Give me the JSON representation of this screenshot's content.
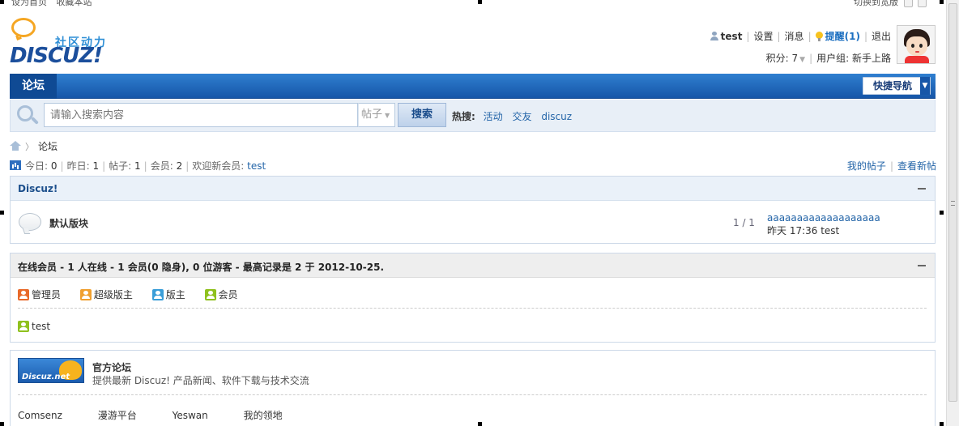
{
  "topbar": {
    "left_items": [
      "设为首页",
      "收藏本站"
    ],
    "right_label": "切换到宽版"
  },
  "logo": {
    "cn": "社区动力",
    "en": "DISCUZ!"
  },
  "user": {
    "name": "test",
    "settings": "设置",
    "messages": "消息",
    "notice": "提醒(1)",
    "logout": "退出",
    "points": "积分: 7",
    "group": "用户组: 新手上路"
  },
  "nav": {
    "forum": "论坛",
    "quicknav": "快捷导航"
  },
  "search": {
    "placeholder": "请输入搜索内容",
    "type": "帖子",
    "button": "搜索",
    "hot_label": "热搜:",
    "hot": [
      "活动",
      "交友",
      "discuz"
    ]
  },
  "breadcrumb": {
    "current": "论坛"
  },
  "stats": {
    "today_label": "今日:",
    "today": "0",
    "yesterday_label": "昨日:",
    "yesterday": "1",
    "posts_label": "帖子:",
    "posts": "1",
    "members_label": "会员:",
    "members": "2",
    "welcome_label": "欢迎新会员:",
    "welcome_user": "test",
    "my_posts": "我的帖子",
    "new_posts": "查看新帖"
  },
  "category": {
    "title": "Discuz!",
    "forum": {
      "name": "默认版块",
      "count": "1 / 1",
      "last_title": "aaaaaaaaaaaaaaaaaaa",
      "last_meta": "昨天 17:36 test"
    }
  },
  "online": {
    "title": "在线会员 - 1 人在线 - 1 会员(0 隐身), 0 位游客 - 最高记录是 2 于 2012-10-25.",
    "roles": [
      {
        "label": "管理员",
        "color": "#e8692a"
      },
      {
        "label": "超级版主",
        "color": "#f0a030"
      },
      {
        "label": "版主",
        "color": "#3a9ed8"
      },
      {
        "label": "会员",
        "color": "#8fc11e"
      }
    ],
    "user": "test",
    "user_color": "#8fc11e"
  },
  "links": {
    "badge": "Discuz.net",
    "title": "官方论坛",
    "desc": "提供最新 Discuz! 产品新闻、软件下载与技术交流",
    "items": [
      "Comsenz",
      "漫游平台",
      "Yeswan",
      "我的领地"
    ]
  }
}
